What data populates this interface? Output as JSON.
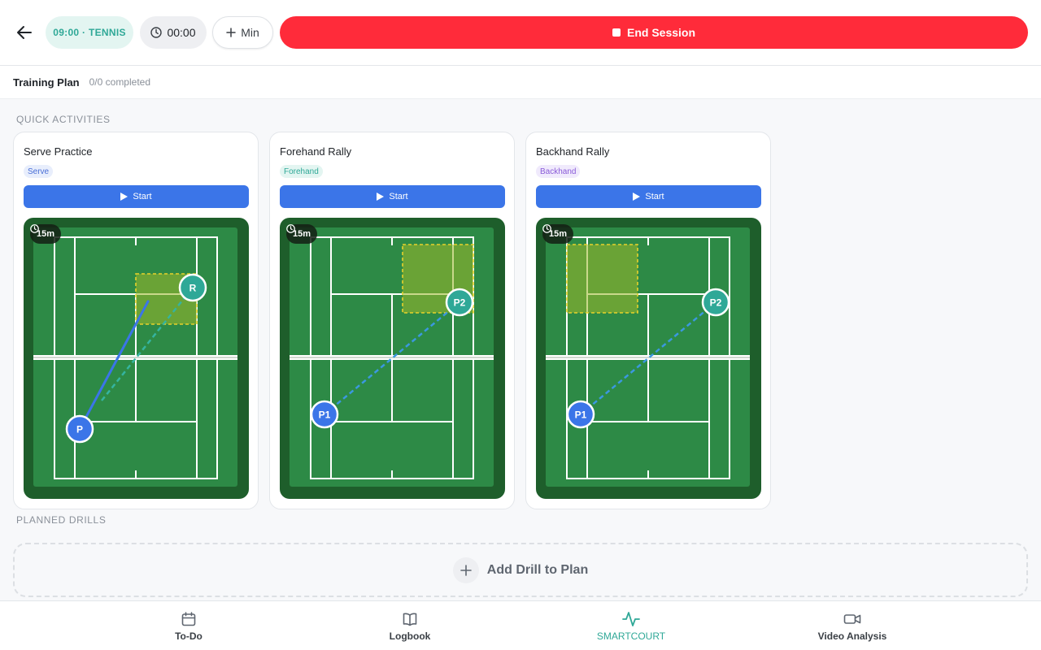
{
  "header": {
    "session_label": "09:00 · TENNIS",
    "timer": "00:00",
    "min_label": "Min",
    "end_label": "End Session"
  },
  "plan": {
    "title": "Training Plan",
    "count": "0/0 completed"
  },
  "sections": {
    "quick": "QUICK ACTIVITIES",
    "planned": "PLANNED DRILLS"
  },
  "activities": [
    {
      "title": "Serve Practice",
      "tag": "Serve",
      "start": "Start",
      "duration": "15m",
      "players": [
        "P",
        "R"
      ]
    },
    {
      "title": "Forehand Rally",
      "tag": "Forehand",
      "start": "Start",
      "duration": "15m",
      "players": [
        "P1",
        "P2"
      ]
    },
    {
      "title": "Backhand Rally",
      "tag": "Backhand",
      "start": "Start",
      "duration": "15m",
      "players": [
        "P1",
        "P2"
      ]
    }
  ],
  "add_drill": "Add Drill to Plan",
  "nav": {
    "todo": "To-Do",
    "logbook": "Logbook",
    "smartcourt": "SMARTCOURT",
    "video": "Video Analysis"
  },
  "colors": {
    "accent": "#2fa897",
    "danger": "#ff2b3a",
    "primary": "#3b75e8",
    "court_outer": "#1e5e2b",
    "court_inner": "#2d8a46",
    "target_zone": "#9cb82a"
  },
  "icons": {
    "back": "arrow-left-icon",
    "clock": "clock-icon",
    "plus": "plus-icon",
    "stop": "stop-icon",
    "play": "play-icon",
    "calendar": "calendar-icon",
    "book": "book-icon",
    "activity": "activity-icon",
    "video": "video-icon"
  }
}
